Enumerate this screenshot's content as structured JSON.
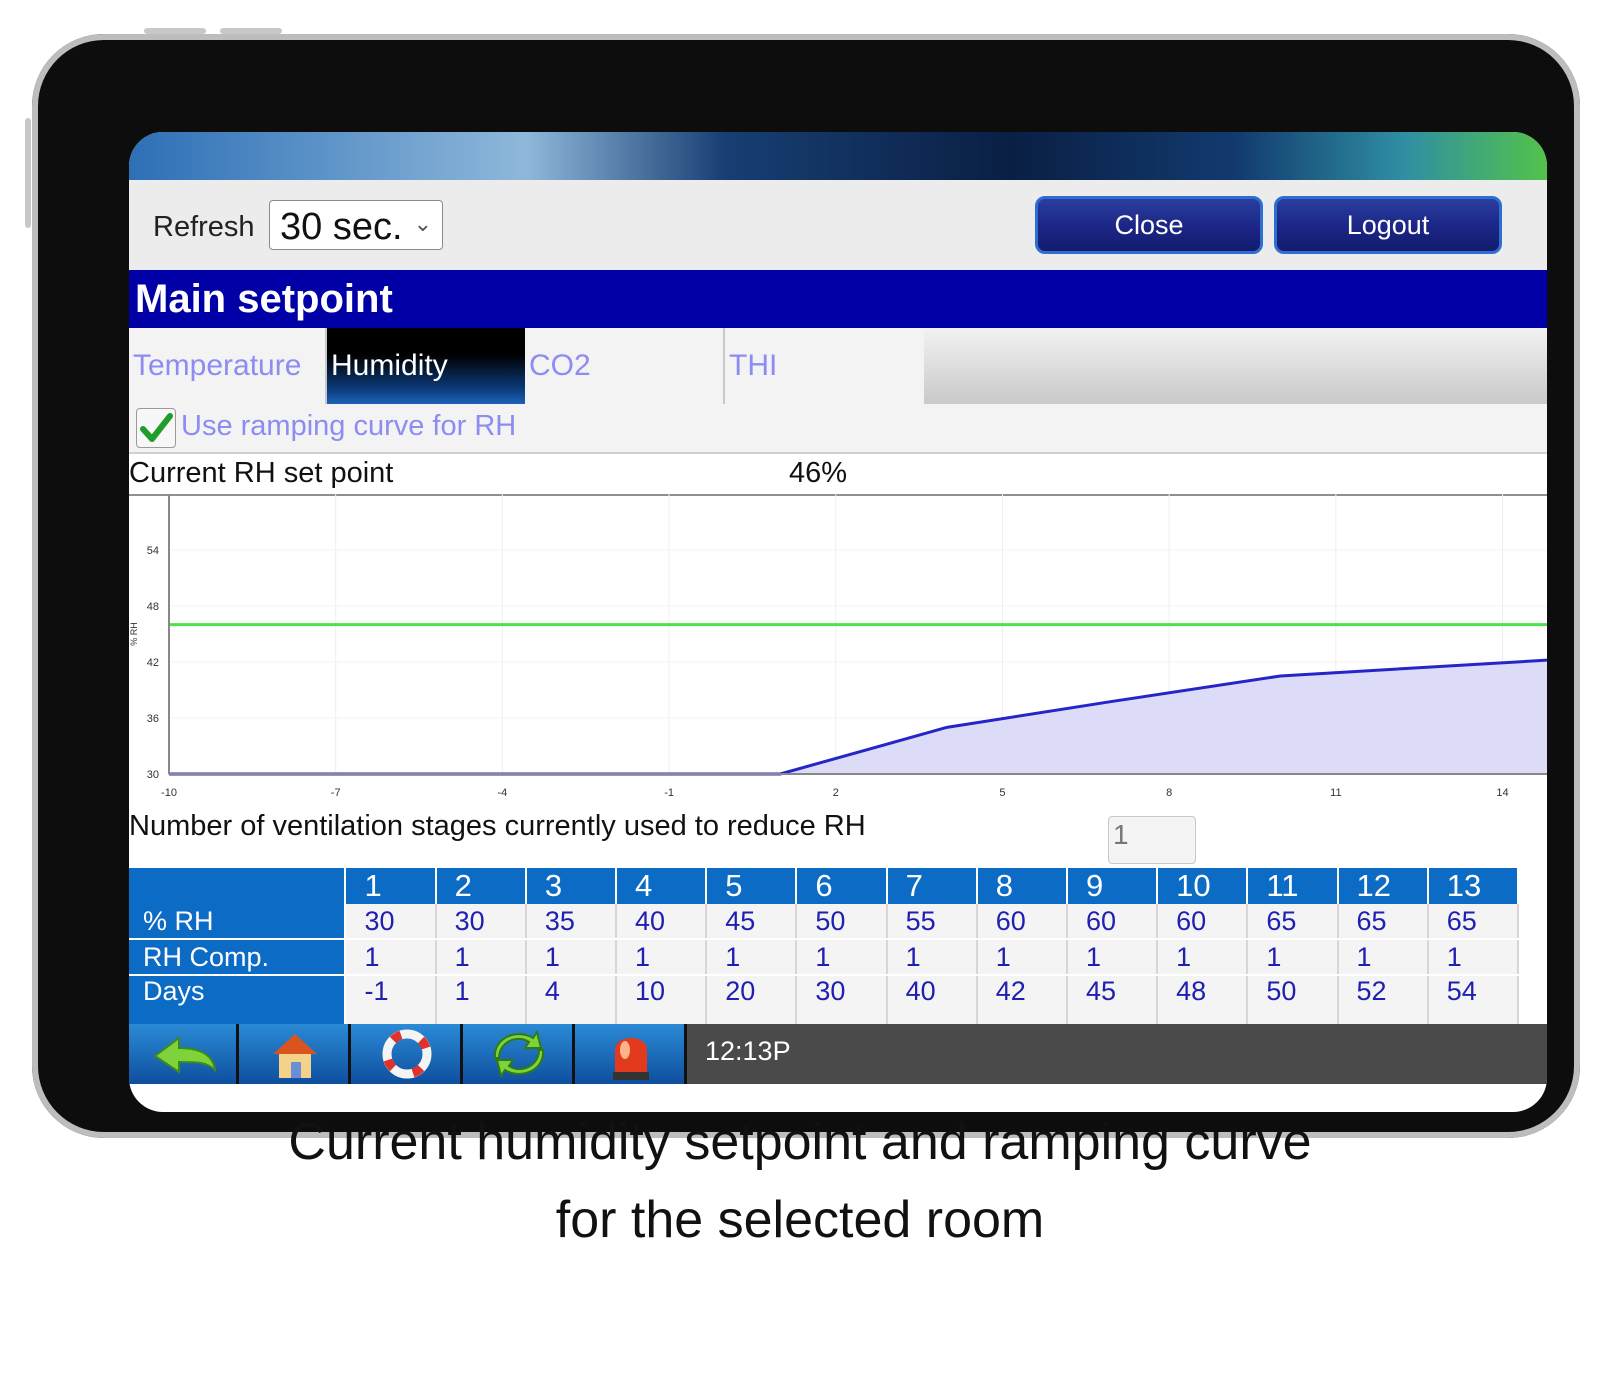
{
  "toolbar": {
    "refresh_label": "Refresh",
    "refresh_value": "30 sec.",
    "close_label": "Close",
    "logout_label": "Logout"
  },
  "page_title": "Main setpoint",
  "tabs": [
    {
      "label": "Temperature",
      "active": false
    },
    {
      "label": "Humidity",
      "active": true
    },
    {
      "label": "CO2",
      "active": false
    },
    {
      "label": "THI",
      "active": false
    }
  ],
  "ramping": {
    "label": "Use ramping curve for RH",
    "checked": true
  },
  "current_rh": {
    "label": "Current RH set point",
    "value": "46%"
  },
  "chart_data": {
    "type": "area",
    "ylabel": "% RH",
    "xlim": [
      -10,
      14.8
    ],
    "ylim": [
      30,
      60
    ],
    "x_ticks": [
      "-10",
      "-7",
      "-4",
      "-1",
      "2",
      "5",
      "8",
      "11",
      "14"
    ],
    "y_ticks": [
      "30",
      "36",
      "42",
      "48",
      "54"
    ],
    "setpoint_line": 46,
    "series": [
      {
        "x": [
          -10,
          1,
          4,
          7,
          10,
          14.8
        ],
        "y": [
          30,
          30,
          35,
          37.8,
          40.5,
          42.2
        ]
      }
    ],
    "colors": {
      "curve": "#2525c8",
      "fill": "#dcdcf8",
      "setpoint": "#4ce24c"
    }
  },
  "stages": {
    "label": "Number of ventilation stages currently used to reduce RH",
    "value": "1"
  },
  "table": {
    "columns": [
      "1",
      "2",
      "3",
      "4",
      "5",
      "6",
      "7",
      "8",
      "9",
      "10",
      "11",
      "12",
      "13"
    ],
    "rows": [
      {
        "label": "% RH",
        "values": [
          "30",
          "30",
          "35",
          "40",
          "45",
          "50",
          "55",
          "60",
          "60",
          "60",
          "65",
          "65",
          "65"
        ]
      },
      {
        "label": "RH Comp.",
        "values": [
          "1",
          "1",
          "1",
          "1",
          "1",
          "1",
          "1",
          "1",
          "1",
          "1",
          "1",
          "1",
          "1"
        ]
      },
      {
        "label": "Days",
        "values": [
          "-1",
          "1",
          "4",
          "10",
          "20",
          "30",
          "40",
          "42",
          "45",
          "48",
          "50",
          "52",
          "54"
        ]
      }
    ]
  },
  "nav": {
    "icons": [
      "back-arrow-icon",
      "home-icon",
      "lifebuoy-icon",
      "recycle-icon",
      "alarm-light-icon"
    ],
    "clock": "12:13P"
  },
  "caption": {
    "line1": "Current humidity setpoint and ramping curve",
    "line2": "for the selected room"
  }
}
